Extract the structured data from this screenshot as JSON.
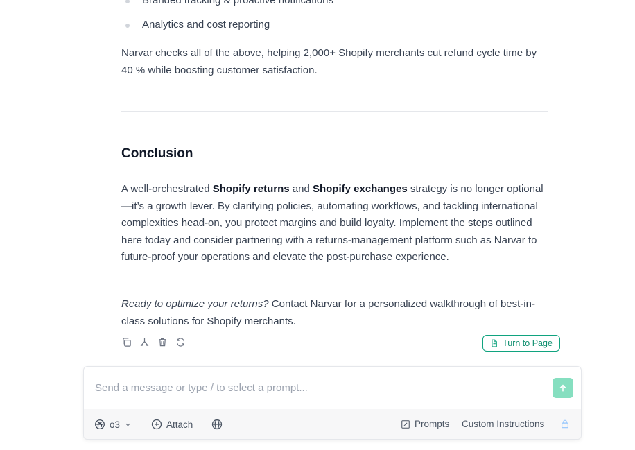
{
  "article": {
    "bullets": [
      "Branded tracking & proactive notifications",
      "Analytics and cost reporting"
    ],
    "summary_para": "Narvar checks all of the above, helping 2,000+ Shopify merchants cut refund cycle time by 40 % while boosting customer satisfaction.",
    "conclusion_heading": "Conclusion",
    "conclusion": {
      "t1": "A well-orchestrated ",
      "b1": "Shopify returns",
      "t2": " and ",
      "b2": "Shopify exchanges",
      "t3": " strategy is no longer optional—it’s a growth lever. By clarifying policies, automating workflows, and tackling international complexities head-on, you protect margins and build loyalty. Implement the steps outlined here today and consider partnering with a returns-management platform such as Narvar to future-proof your operations and elevate the post-purchase experience."
    },
    "cta": {
      "italic": "Ready to optimize your returns?",
      "rest": " Contact Narvar for a personalized walkthrough of best-in-class solutions for Shopify merchants."
    }
  },
  "message_actions": {
    "icons": [
      "copy-icon",
      "branch-icon",
      "trash-icon",
      "refresh-icon"
    ],
    "turn_to_page_label": "Turn to Page"
  },
  "composer": {
    "placeholder": "Send a message or type / to select a prompt...",
    "model_label": "o3",
    "attach_label": "Attach",
    "prompts_label": "Prompts",
    "custom_instructions_label": "Custom Instructions"
  },
  "colors": {
    "accent": "#10a37f",
    "send_button": "#86dfc0",
    "toolbar_bg": "#f7f7f8"
  }
}
